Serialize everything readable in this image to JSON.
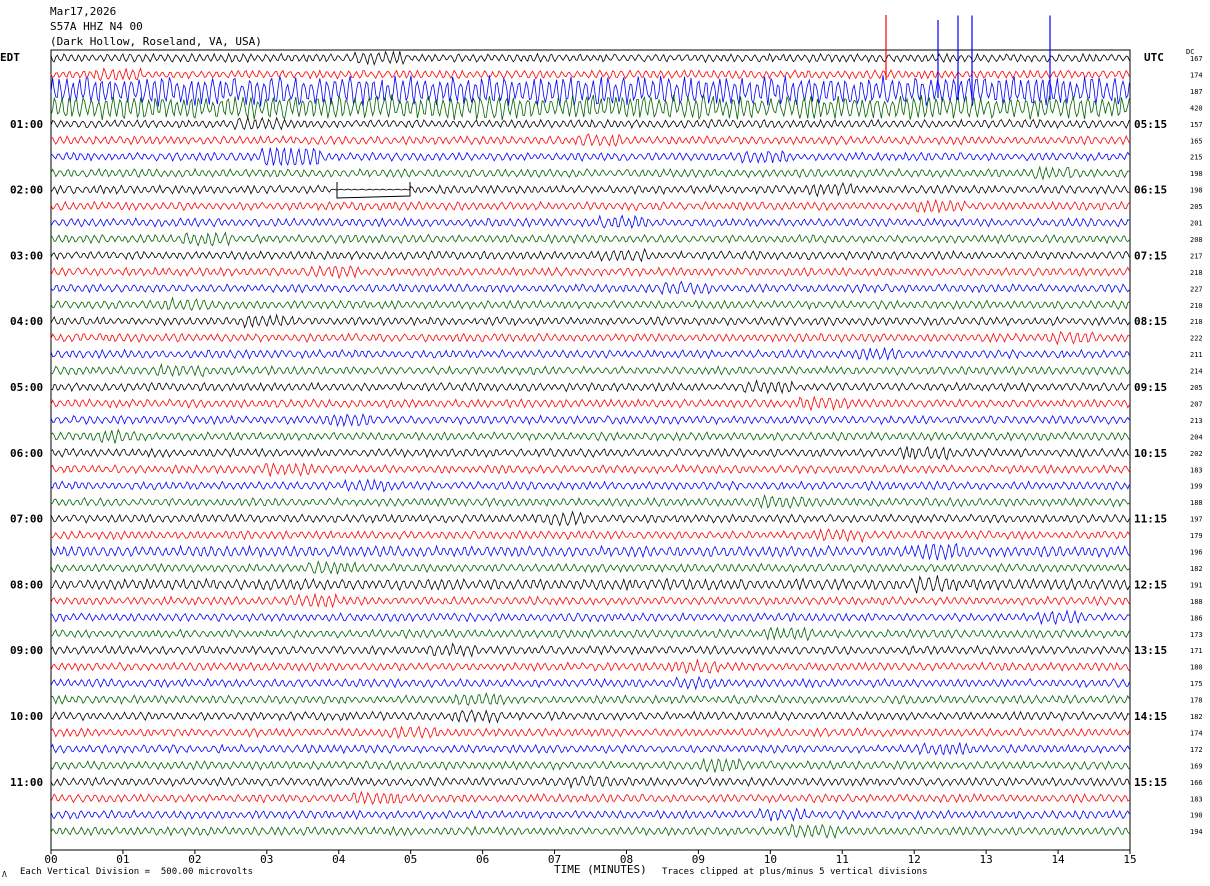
{
  "header": {
    "date": "Mar17,2026",
    "station": "S57A HHZ N4 00",
    "location": "(Dark Hollow, Roseland, VA, USA)"
  },
  "left_timezone": "EDT",
  "right_timezone": "UTC",
  "dc_label": "DC",
  "footer": {
    "scale_note": "Each Vertical Division =  500.00 microvolts",
    "clip_note": "Traces clipped at plus/minus 5 vertical divisions",
    "corner_mark": "Λ"
  },
  "colors": {
    "cycle": [
      "#000000",
      "#ff0000",
      "#0000ff",
      "#006400"
    ]
  },
  "chart_data": {
    "type": "line",
    "xlabel": "TIME (MINUTES)",
    "xlim": [
      0,
      15
    ],
    "x_ticks": [
      "00",
      "01",
      "02",
      "03",
      "04",
      "05",
      "06",
      "07",
      "08",
      "09",
      "10",
      "11",
      "12",
      "13",
      "14",
      "15"
    ],
    "left_hour_labels": [
      "01:00",
      "02:00",
      "03:00",
      "04:00",
      "05:00",
      "06:00",
      "07:00",
      "08:00",
      "09:00",
      "10:00",
      "11:00"
    ],
    "right_hour_labels": [
      "05:15",
      "06:15",
      "07:15",
      "08:15",
      "09:15",
      "10:15",
      "11:15",
      "12:15",
      "13:15",
      "14:15",
      "15:15"
    ],
    "trace_offsets": [
      167,
      174,
      187,
      420,
      157,
      165,
      215,
      198,
      198,
      205,
      201,
      208,
      217,
      218,
      227,
      210,
      218,
      222,
      211,
      214,
      205,
      207,
      213,
      204,
      202,
      183,
      199,
      188,
      197,
      179,
      196,
      182,
      191,
      188,
      186,
      173,
      171,
      180,
      175,
      178,
      182,
      174,
      172,
      169,
      166,
      183,
      190,
      194
    ],
    "traces_per_hour": 4,
    "clip_divisions": 5,
    "microvolts_per_division": 500.0
  }
}
